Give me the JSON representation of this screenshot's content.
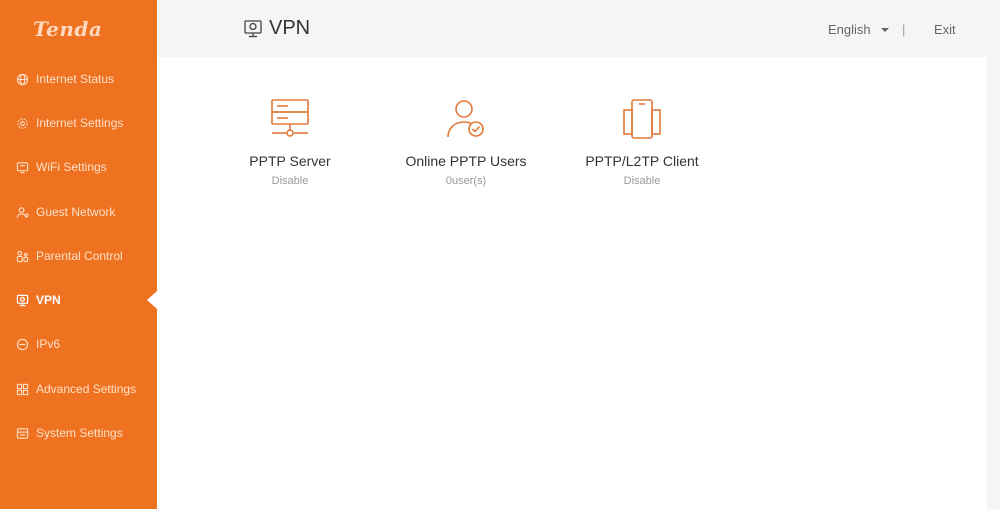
{
  "brand": {
    "logo": "Tenda",
    "accent": "#ef7221"
  },
  "sidebar": {
    "items": [
      {
        "label": "Internet Status",
        "icon": "globe-icon"
      },
      {
        "label": "Internet Settings",
        "icon": "gear-icon"
      },
      {
        "label": "WiFi Settings",
        "icon": "wifi-screen-icon"
      },
      {
        "label": "Guest Network",
        "icon": "guest-icon"
      },
      {
        "label": "Parental Control",
        "icon": "parental-icon"
      },
      {
        "label": "VPN",
        "icon": "vpn-monitor-icon",
        "active": true
      },
      {
        "label": "IPv6",
        "icon": "ipv6-icon"
      },
      {
        "label": "Advanced Settings",
        "icon": "grid-icon"
      },
      {
        "label": "System Settings",
        "icon": "system-icon"
      }
    ]
  },
  "header": {
    "title": "VPN",
    "language": "English",
    "separator": "|",
    "exit": "Exit"
  },
  "cards": [
    {
      "title": "PPTP Server",
      "status": "Disable",
      "icon": "server-icon"
    },
    {
      "title": "Online PPTP Users",
      "status": "0user(s)",
      "icon": "user-check-icon"
    },
    {
      "title": "PPTP/L2TP Client",
      "status": "Disable",
      "icon": "phone-icon"
    }
  ]
}
